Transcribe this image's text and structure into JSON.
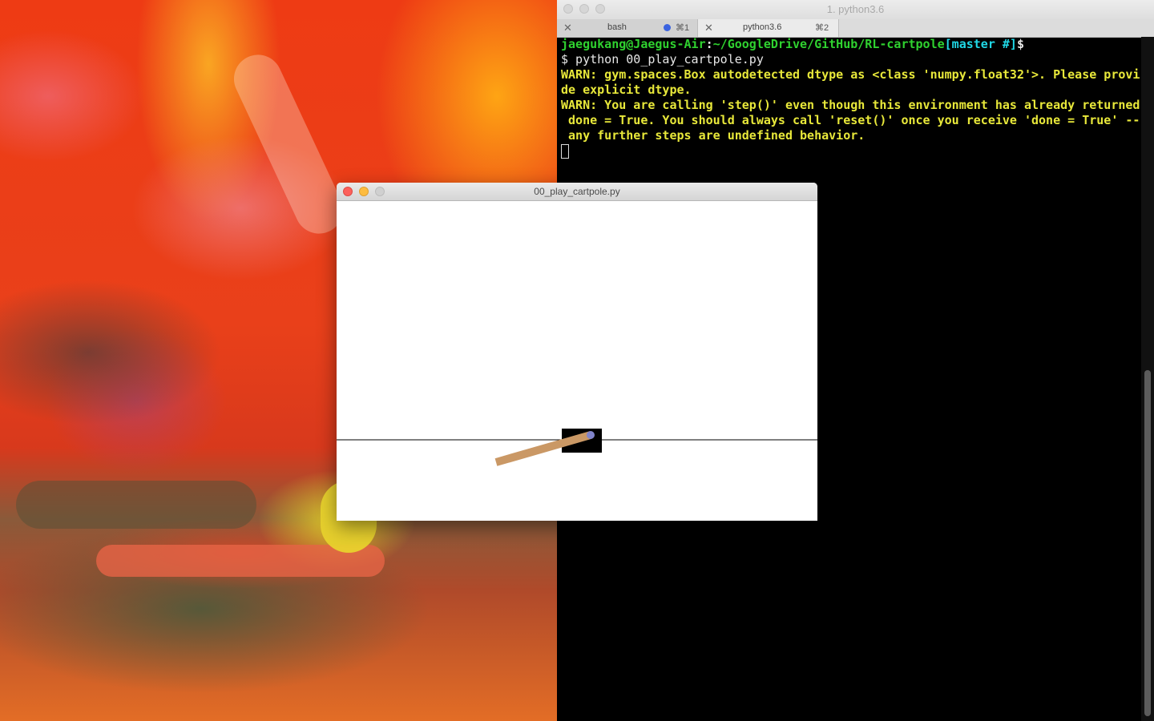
{
  "terminal_window": {
    "title": "1. python3.6",
    "tabs": [
      {
        "label": "bash",
        "shortcut": "⌘1",
        "active": false,
        "activity": true
      },
      {
        "label": "python3.6",
        "shortcut": "⌘2",
        "active": true,
        "activity": false
      }
    ],
    "prompt": {
      "user_host": "jaegukang@Jaegus-Air",
      "colon": ":",
      "path": "~/GoogleDrive/GitHub/RL-cartpole",
      "branch": "[master #]",
      "dollar": "$"
    },
    "command_line": "$ python 00_play_cartpole.py",
    "output_lines": [
      "WARN: gym.spaces.Box autodetected dtype as <class 'numpy.float32'>. Please provi",
      "de explicit dtype.",
      "WARN: You are calling 'step()' even though this environment has already returned",
      " done = True. You should always call 'reset()' once you receive 'done = True' --",
      " any further steps are undefined behavior."
    ]
  },
  "render_window": {
    "title": "00_play_cartpole.py",
    "scene": {
      "cart_position": 0.45,
      "pole_angle_deg": -70
    }
  },
  "colors": {
    "prompt_green": "#2fd12f",
    "branch_cyan": "#20d8e6",
    "warn_yellow": "#e8e83a",
    "pole": "#ca9865",
    "axle": "#8184cb",
    "cart": "#000000",
    "close_red": "#fc605b",
    "minimize_yellow": "#fdbc40",
    "zoom_gray": "#d0d0d0"
  }
}
